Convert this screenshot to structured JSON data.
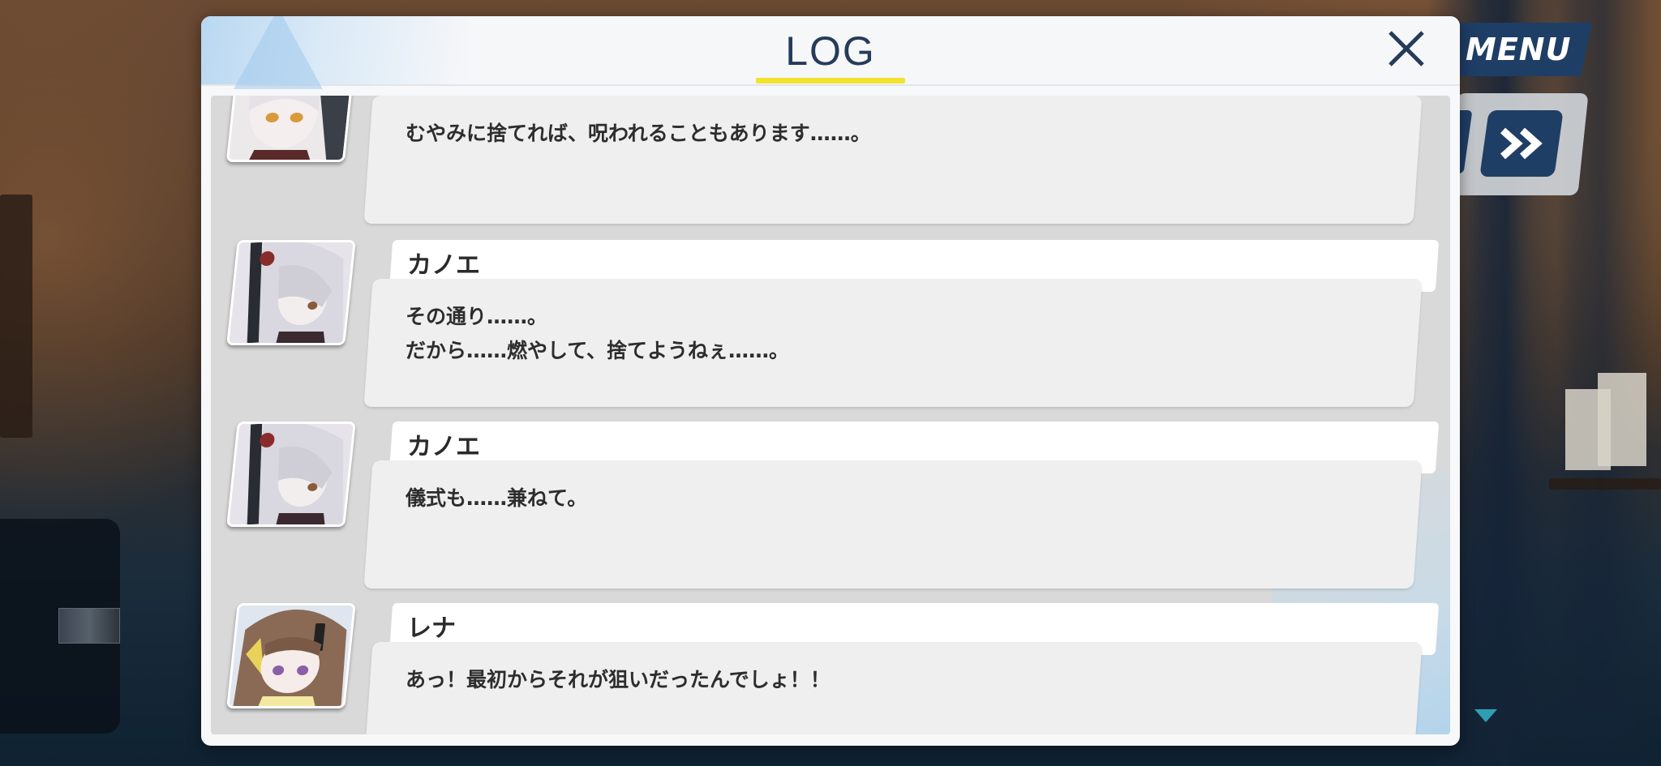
{
  "header": {
    "title": "LOG",
    "close_icon": "close-icon",
    "accent_underline": "#f2e32d"
  },
  "controls": {
    "menu_label": "MENU",
    "skip_icon": "fast-forward-icon",
    "scroll_indicator_icon": "triangle-down-icon"
  },
  "log_entries": [
    {
      "speaker": "",
      "portrait": "character-portrait-white-hair-red-eyes",
      "lines": [
        "むやみに捨てれば、呪われることもあります……。"
      ]
    },
    {
      "speaker": "カノエ",
      "portrait": "character-portrait-kanoe",
      "lines": [
        "その通り……。",
        "だから……燃やして、捨てようねぇ……。"
      ]
    },
    {
      "speaker": "カノエ",
      "portrait": "character-portrait-kanoe",
      "lines": [
        "儀式も……兼ねて。"
      ]
    },
    {
      "speaker": "レナ",
      "portrait": "character-portrait-rena",
      "lines": [
        "あっ！最初からそれが狙いだったんでしょ！！"
      ]
    }
  ],
  "colors": {
    "title_text": "#253b5a",
    "button_navy": "#1f3e66",
    "log_panel": "#d9d9d9",
    "bubble": "#efefef"
  }
}
